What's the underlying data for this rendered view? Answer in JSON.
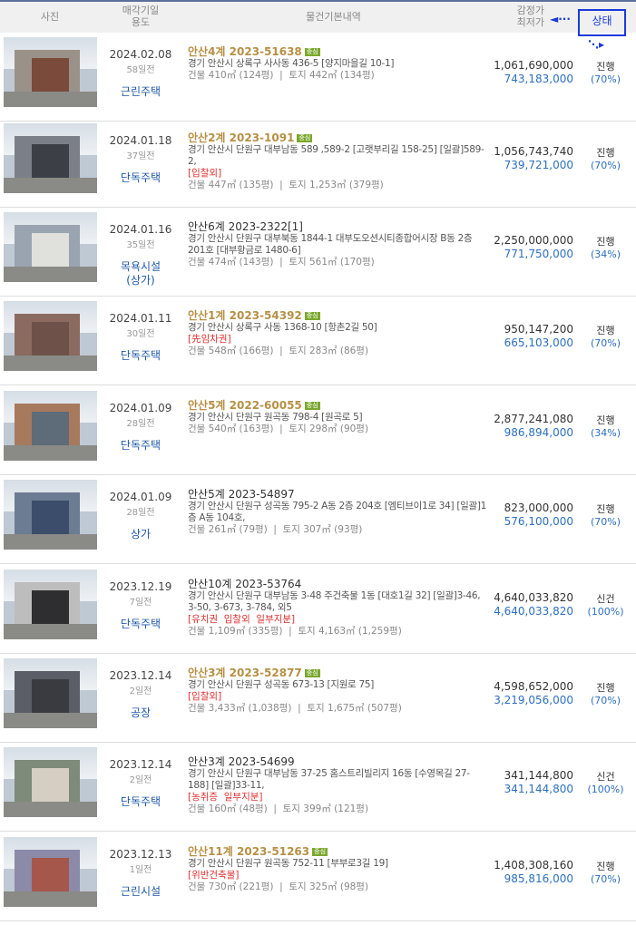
{
  "header": {
    "photo": "사진",
    "date_line1": "매각기일",
    "date_line2": "용도",
    "basic": "물건기본내역",
    "price_line1": "감정가",
    "price_line2": "최저가",
    "status": "상태"
  },
  "rows": [
    {
      "date": "2024.02.08",
      "days": "58일전",
      "usage": "근린주택",
      "case": "안산4계 2023-51638",
      "badge": "중심",
      "highlight": true,
      "addr": "경기 안산시 상록구 사사동 436-5 [양지마을길 10-1]",
      "warn": "",
      "area": "건물 410㎡ (124평)  |  토지 442㎡ (134평)",
      "appraisal": "1,061,690,000",
      "minimum": "743,183,000",
      "status": "진행",
      "rate": "(70%)"
    },
    {
      "date": "2024.01.18",
      "days": "37일전",
      "usage": "단독주택",
      "case": "안산2계 2023-1091",
      "badge": "중심",
      "highlight": true,
      "addr": "경기 안산시 단원구 대부남동 589 ,589-2 [고랫부리길 158-25] [일괄]589-2,",
      "warn": "[입찰외]",
      "area": "건물 447㎡ (135평)  |  토지 1,253㎡ (379평)",
      "appraisal": "1,056,743,740",
      "minimum": "739,721,000",
      "status": "진행",
      "rate": "(70%)"
    },
    {
      "date": "2024.01.16",
      "days": "35일전",
      "usage": "목욕시설\n(상가)",
      "case": "안산6계 2023-2322[1]",
      "badge": "",
      "highlight": false,
      "addr": "경기 안산시 단원구 대부북동 1844-1 대부도오션시티종합어시장 B동 2층 201호 [대부황금로 1480-6]",
      "warn": "",
      "area": "건물 474㎡ (143평)  |  토지 561㎡ (170평)",
      "appraisal": "2,250,000,000",
      "minimum": "771,750,000",
      "status": "진행",
      "rate": "(34%)"
    },
    {
      "date": "2024.01.11",
      "days": "30일전",
      "usage": "단독주택",
      "case": "안산1계 2023-54392",
      "badge": "중심",
      "highlight": true,
      "addr": "경기 안산시 상록구 사동 1368-10 [항촌2길 50]",
      "warn": "[先임차권]",
      "area": "건물 548㎡ (166평)  |  토지 283㎡ (86평)",
      "appraisal": "950,147,200",
      "minimum": "665,103,000",
      "status": "진행",
      "rate": "(70%)"
    },
    {
      "date": "2024.01.09",
      "days": "28일전",
      "usage": "단독주택",
      "case": "안산5계 2022-60055",
      "badge": "중심",
      "highlight": true,
      "addr": "경기 안산시 단원구 원곡동 798-4 [원곡로 5]",
      "warn": "",
      "area": "건물 540㎡ (163평)  |  토지 298㎡ (90평)",
      "appraisal": "2,877,241,080",
      "minimum": "986,894,000",
      "status": "진행",
      "rate": "(34%)"
    },
    {
      "date": "2024.01.09",
      "days": "28일전",
      "usage": "상가",
      "case": "안산5계 2023-54897",
      "badge": "",
      "highlight": false,
      "addr": "경기 안산시 단원구 성곡동 795-2 A동 2층 204호 [엠티브이1로 34] [일괄]1층 A동 104호,",
      "warn": "",
      "area": "건물 261㎡ (79평)  |  토지 307㎡ (93평)",
      "appraisal": "823,000,000",
      "minimum": "576,100,000",
      "status": "진행",
      "rate": "(70%)"
    },
    {
      "date": "2023.12.19",
      "days": "7일전",
      "usage": "단독주택",
      "case": "안산10계 2023-53764",
      "badge": "",
      "highlight": false,
      "addr": "경기 안산시 단원구 대부남동 3-48 주건축물 1동 [대호1길 32] [일괄]3-46, 3-50, 3-673, 3-784, 외5",
      "warn": "[유치권  입찰외  일부지분]",
      "area": "건물 1,109㎡ (335평)  |  토지 4,163㎡ (1,259평)",
      "appraisal": "4,640,033,820",
      "minimum": "4,640,033,820",
      "status": "신건",
      "rate": "(100%)"
    },
    {
      "date": "2023.12.14",
      "days": "2일전",
      "usage": "공장",
      "case": "안산3계 2023-52877",
      "badge": "중심",
      "highlight": true,
      "addr": "경기 안산시 단원구 성곡동 673-13 [지원로 75]",
      "warn": "[입찰외]",
      "area": "건물 3,433㎡ (1,038평)  |  토지 1,675㎡ (507평)",
      "appraisal": "4,598,652,000",
      "minimum": "3,219,056,000",
      "status": "진행",
      "rate": "(70%)"
    },
    {
      "date": "2023.12.14",
      "days": "2일전",
      "usage": "단독주택",
      "case": "안산3계 2023-54699",
      "badge": "",
      "highlight": false,
      "addr": "경기 안산시 단원구 대부남동 37-25 홈스트리빌리지 16동 [수영목길 27-188] [일괄]33-11,",
      "warn": "[농취증  일부지분]",
      "area": "건물 160㎡ (48평)  |  토지 399㎡ (121평)",
      "appraisal": "341,144,800",
      "minimum": "341,144,800",
      "status": "신건",
      "rate": "(100%)"
    },
    {
      "date": "2023.12.13",
      "days": "1일전",
      "usage": "근린시설",
      "case": "안산11계 2023-51263",
      "badge": "중심",
      "highlight": true,
      "addr": "경기 안산시 단원구 원곡동 752-11 [부부로3길 19]",
      "warn": "[위반건축물]",
      "area": "건물 730㎡ (221평)  |  토지 325㎡ (98평)",
      "appraisal": "1,408,308,160",
      "minimum": "985,816,000",
      "status": "진행",
      "rate": "(70%)"
    }
  ],
  "photo_icons": [
    "building-photo"
  ]
}
